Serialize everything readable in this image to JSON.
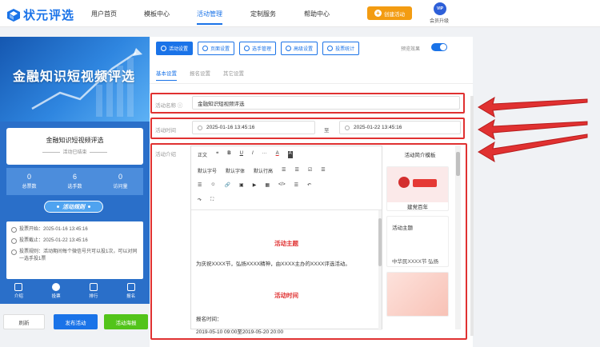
{
  "brand": {
    "name": "状元评选"
  },
  "nav": {
    "items": [
      "用户首页",
      "模板中心",
      "活动管理",
      "定制服务",
      "帮助中心"
    ],
    "create_label": "创建活动",
    "vip_badge": "VIP",
    "vip_label": "会员升级"
  },
  "preview": {
    "banner_title": "金融知识短视频评选",
    "activity_name": "金融知识短视频评选",
    "activity_status": "活动已结束",
    "stats": [
      {
        "value": "0",
        "label": "总票数"
      },
      {
        "value": "6",
        "label": "选手数"
      },
      {
        "value": "0",
        "label": "访问量"
      }
    ],
    "rules_button": "活动规则",
    "info": [
      "投票开始：2025-01-16 13:45:16",
      "投票截止：2025-01-22 13:45:16",
      "投票规则：活动期间每个微信号只可以投1次，可以对同一选手投1票"
    ],
    "tabs": [
      "介绍",
      "投票",
      "排行",
      "报名"
    ]
  },
  "bottom_buttons": {
    "refresh": "刷新",
    "publish": "发布活动",
    "poster": "活动海报"
  },
  "colors": {
    "accent": "#1a73e8",
    "orange": "#f39c12",
    "green": "#52c41a",
    "red": "#e03131",
    "panel_blue": "#2a6fc9"
  },
  "editor": {
    "top_tabs": [
      "活动设置",
      "页面设置",
      "选手管理",
      "高级设置",
      "投票统计"
    ],
    "preview_toggle_label": "预览效果",
    "sub_tabs": [
      "基本设置",
      "报名设置",
      "其它设置"
    ],
    "name_label": "活动名称",
    "name_value": "金融知识短视频评选",
    "time_label": "活动时间",
    "start_time": "2025-01-16 13:45:16",
    "to_label": "至",
    "end_time": "2025-01-22 13:45:16",
    "intro_label": "活动介绍",
    "toolbar_row1": [
      "正文",
      "❝",
      "B",
      "U",
      "I",
      "···",
      "A",
      "A"
    ],
    "toolbar_row2": [
      "默认字号",
      "默认字体",
      "默认行高",
      "☰",
      "☰",
      "☑",
      "☰"
    ],
    "toolbar_row3": [
      "☰",
      "☺",
      "🔗",
      "▣",
      "▶",
      "▦",
      "</>",
      "☰",
      "↶"
    ],
    "toolbar_row4": [
      "↷",
      "⛶"
    ],
    "content": {
      "heading1": "活动主题",
      "para1": "为庆祝XXXX节，弘扬XXXX精神，由XXXX主办的XXXX评选活动。",
      "heading2": "活动时间",
      "para2": "报名时间：",
      "para3": "2019-05-10 09:00至2019-05-20 20:00"
    },
    "templates_title": "活动简介模板",
    "template_cards": [
      "建党百年",
      "活动主题",
      "中华民XXXX节 弘扬"
    ]
  }
}
